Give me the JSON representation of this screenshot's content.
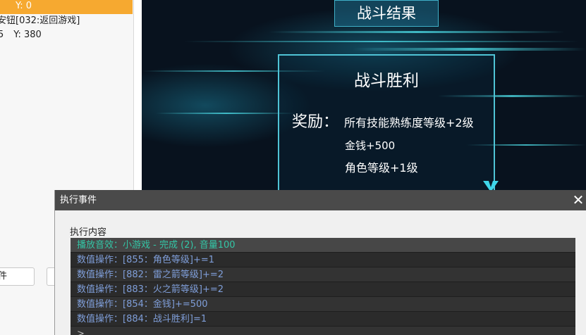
{
  "left_panel": {
    "selected_row": "Y:  0",
    "row_1": "安钮[032:返回游戏]",
    "row_2_x": "5",
    "row_2_y": "Y:  380",
    "button_1": "件"
  },
  "preview": {
    "title": "战斗结果",
    "result_title": "战斗胜利",
    "reward_label": "奖励：",
    "rewards": [
      "所有技能熟练度等级+2级",
      "金钱+500",
      "角色等级+1级"
    ]
  },
  "dialog": {
    "title": "执行事件",
    "close_icon": "close-icon",
    "content_label": "执行内容",
    "commands": [
      "播放音效：小游戏 - 完成 (2), 音量100",
      "数值操作：[855：角色等级]+=1",
      "数值操作：[882：雷之箭等级]+=2",
      "数值操作：[883：火之箭等级]+=2",
      "数值操作：[854：金钱]+=500",
      "数值操作：[884：战斗胜利]=1",
      ">"
    ]
  },
  "colors": {
    "selected_row": "#f6a930",
    "sound_command": "#33c6a6",
    "variable_command": "#7f9ed9",
    "titlebar": "#4a4a4a"
  }
}
